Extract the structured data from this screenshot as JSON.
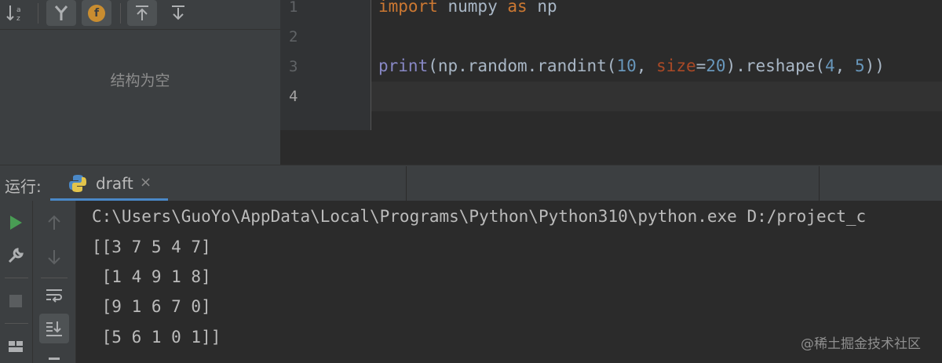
{
  "structure": {
    "empty_message": "结构为空",
    "toolbar": {
      "sort_alpha_icon": "sort-alphabetically-icon",
      "filter_icon": "filter-icon",
      "fields_badge": "f",
      "expand_icon": "expand-all-icon",
      "collapse_icon": "collapse-all-icon"
    }
  },
  "editor": {
    "line_numbers": [
      "1",
      "2",
      "3",
      "4"
    ],
    "lines": {
      "l1": {
        "kw1": "import",
        "mod": " numpy ",
        "kw2": "as",
        "alias": " np"
      },
      "l3": {
        "fn": "print",
        "p1": "(np.random.randint(",
        "n1": "10",
        "comma": ", ",
        "param": "size",
        "eq": "=",
        "n2": "20",
        "p2": ").reshape(",
        "n3": "4",
        "comma2": ", ",
        "n4": "5",
        "p3": "))"
      }
    }
  },
  "run": {
    "label": "运行:",
    "tab": {
      "name": "draft",
      "close": "×"
    },
    "console": [
      "C:\\Users\\GuoYo\\AppData\\Local\\Programs\\Python\\Python310\\python.exe D:/project_c",
      "[[3 7 5 4 7]",
      " [1 4 9 1 8]",
      " [9 1 6 7 0]",
      " [5 6 1 0 1]]"
    ]
  },
  "watermark": "@稀土掘金技术社区",
  "colors": {
    "keyword": "#cc7832",
    "builtin": "#8888c6",
    "number": "#6897bb",
    "param": "#aa4926",
    "run_green": "#499c54"
  }
}
